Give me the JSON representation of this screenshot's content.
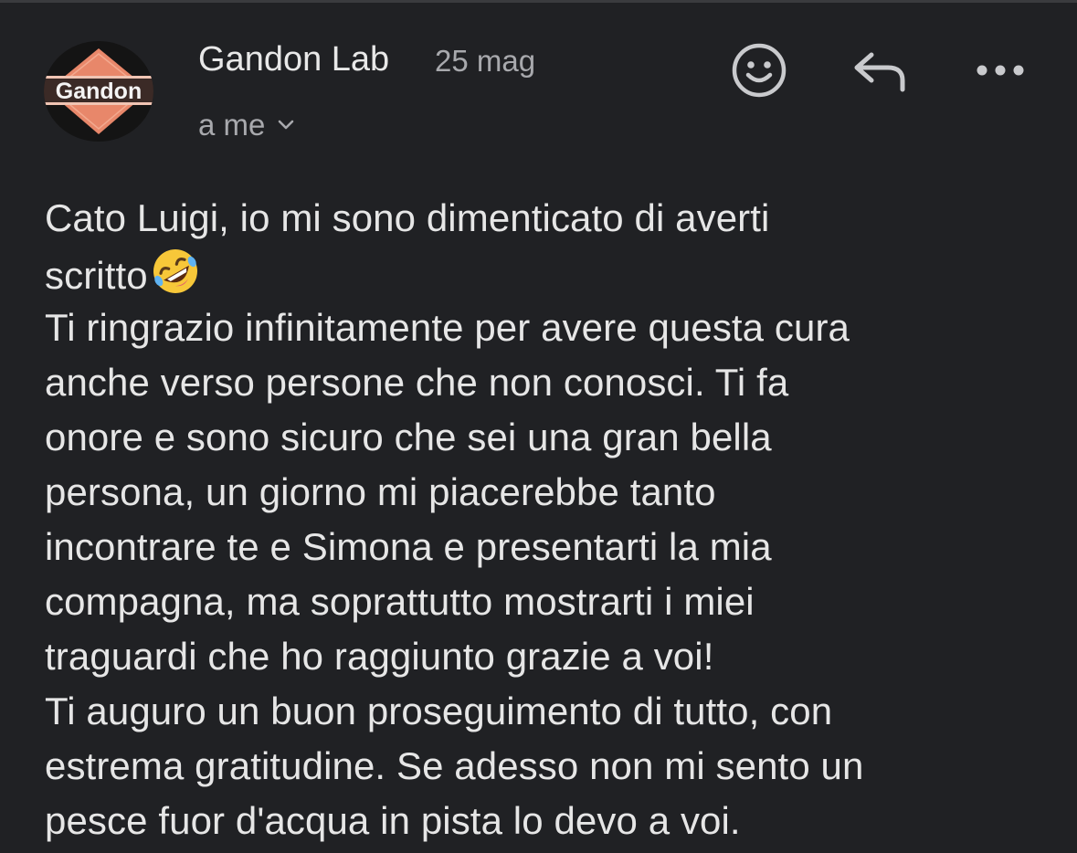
{
  "header": {
    "sender_name": "Gandon Lab",
    "date": "25 mag",
    "recipient": "a me",
    "avatar_text": "Gandon",
    "icons": {
      "avatar": "gandon-logo",
      "emoji": "smiley-face-icon",
      "reply": "reply-arrow-icon",
      "more": "more-horizontal-icon",
      "chevron": "chevron-down-icon"
    }
  },
  "message": {
    "lines": [
      "Cato Luigi, io mi sono dimenticato di averti",
      "scritto",
      "Ti ringrazio infinitamente per avere questa cura",
      "anche verso persone che non conosci. Ti fa",
      "onore e sono sicuro che sei una gran bella",
      "persona, un giorno mi piacerebbe tanto",
      "incontrare te e Simona e presentarti la mia",
      "compagna, ma soprattutto mostrarti i miei",
      "traguardi che ho raggiunto grazie a voi!",
      "Ti auguro un buon proseguimento di tutto, con",
      "estrema gratitudine. Se adesso non mi sento un",
      "pesce fuor d'acqua in pista lo devo a voi."
    ],
    "emoji_after_line_2": "rolling-on-floor-laughing-emoji"
  },
  "colors": {
    "background": "#202124",
    "primary_text": "#e6e6e6",
    "secondary_text": "#a8a9ad",
    "logo_orange": "#e8876a"
  }
}
